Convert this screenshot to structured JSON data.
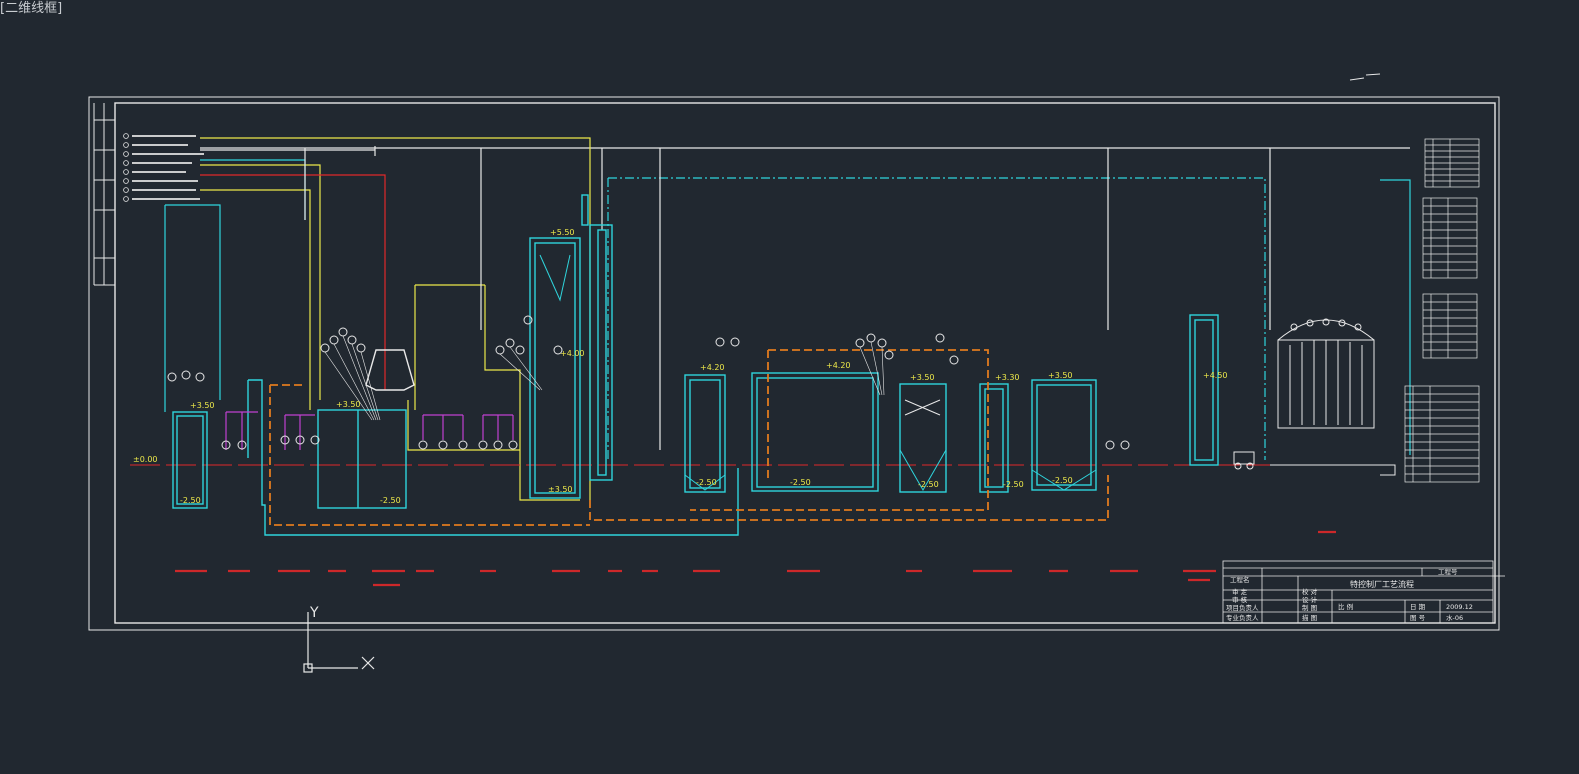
{
  "viewport": {
    "label": "[二维线框]"
  },
  "colors": {
    "background": "#212830",
    "white": "#e8e8e8",
    "cyan": "#2fd4dc",
    "yellow": "#ece84a",
    "orange": "#e07a1e",
    "red": "#e0282a",
    "magenta": "#c040d0",
    "blue": "#3050e8",
    "grey": "#9aa0a6"
  },
  "elevations": {
    "e1": "±0.00",
    "e2": "-2.50",
    "e3": "+3.50",
    "e4": "+3.50",
    "e5": "-2.50",
    "e6": "+5.50",
    "e7": "+4.00",
    "e8": "±3.50",
    "e9": "+4.20",
    "e10": "+4.20",
    "e11": "-2.50",
    "e12": "-2.50",
    "e13": "+3.50",
    "e14": "-2.50",
    "e15": "+3.30",
    "e16": "-2.50",
    "e17": "+3.50",
    "e18": "-2.50",
    "e19": "+4.50"
  },
  "title_block": {
    "project_label": "工程号",
    "drawing_title": "特控制厂工艺流程",
    "rows_left": [
      "工程名",
      "审 定",
      "审 核",
      "项目负责人",
      "专业负责人"
    ],
    "rows_mid": [
      "校 对",
      "设 计",
      "制 图",
      "描 图"
    ],
    "scale_label": "比 例",
    "date_label": "日 期",
    "date_value": "2009.12",
    "sheet_label": "图 号",
    "sheet_value": "水-06"
  },
  "ucs": {
    "y_label": "Y",
    "x_label": "X"
  }
}
